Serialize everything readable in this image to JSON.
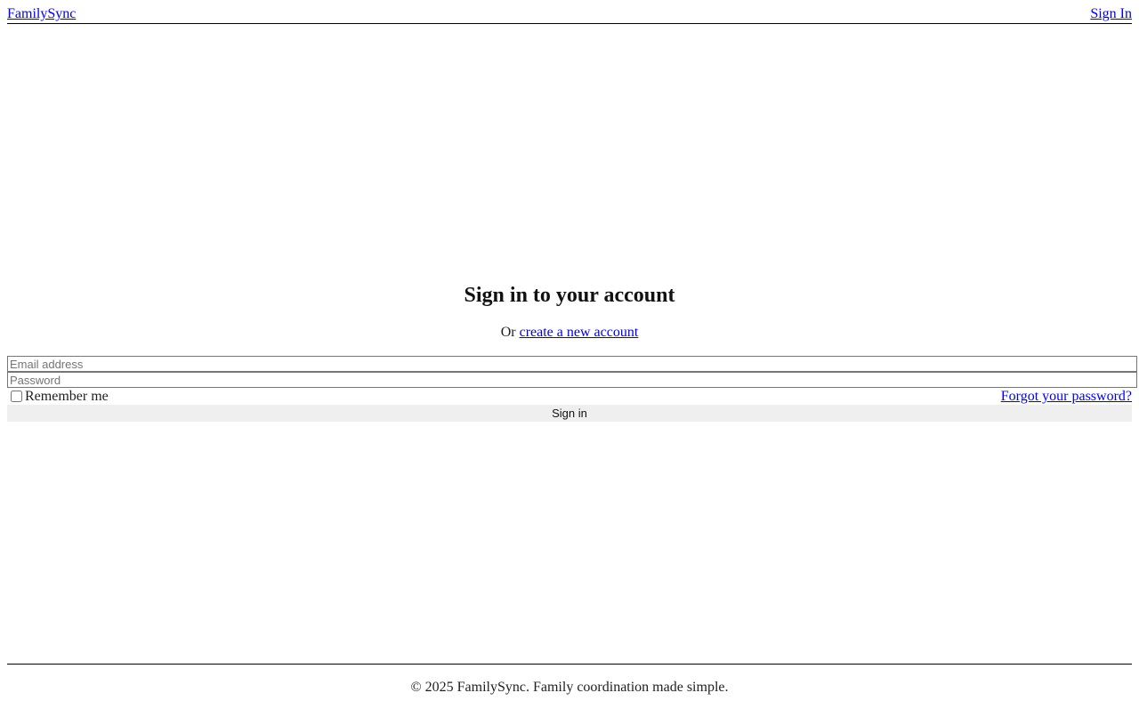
{
  "header": {
    "brand": "FamilySync",
    "signin_link": "Sign In"
  },
  "auth": {
    "title": "Sign in to your account",
    "subtitle_prefix": "Or",
    "create_account_link": "create a new account"
  },
  "form": {
    "email": {
      "placeholder": "Email address",
      "value": ""
    },
    "password": {
      "placeholder": "Password",
      "value": ""
    },
    "remember_label": "Remember me",
    "remember_checked": false,
    "forgot_link": "Forgot your password?",
    "submit_label": "Sign in"
  },
  "footer": {
    "text": "© 2025 FamilySync. Family coordination made simple."
  }
}
